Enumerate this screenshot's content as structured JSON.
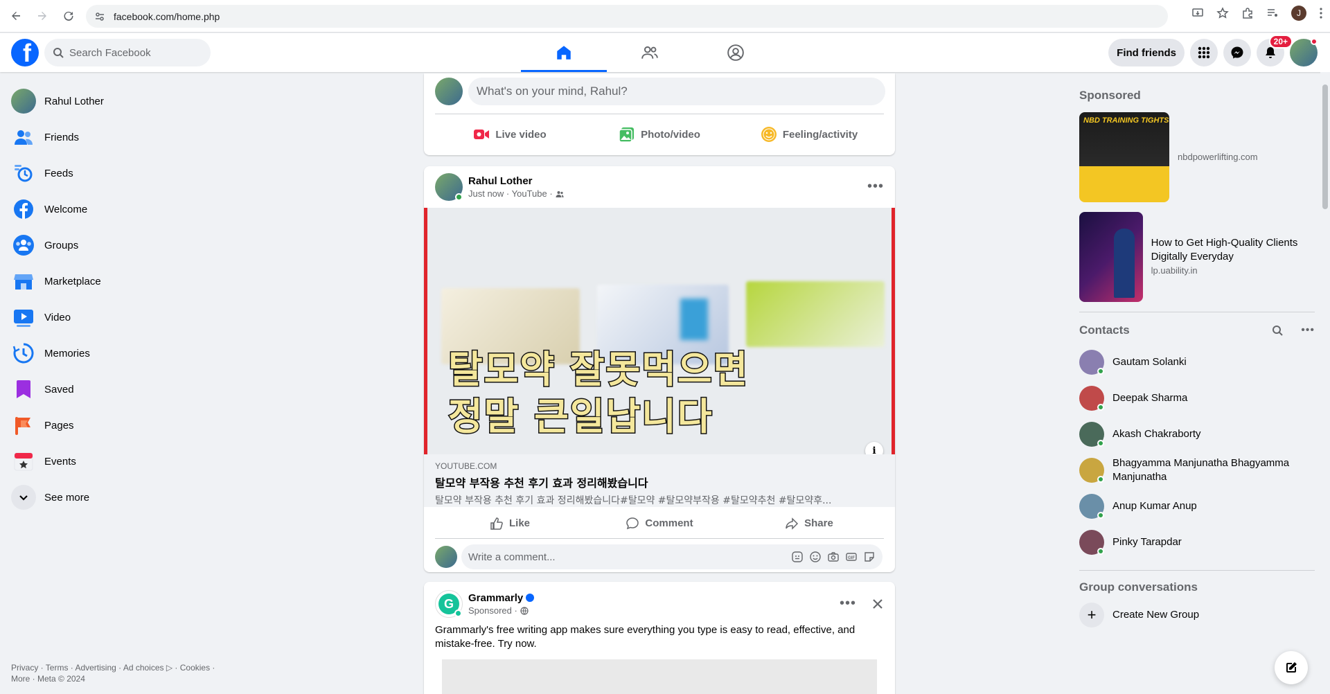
{
  "browser": {
    "url": "facebook.com/home.php",
    "profile_initial": "J"
  },
  "header": {
    "logo": "f",
    "search_placeholder": "Search Facebook",
    "find_friends": "Find friends",
    "notifications_badge": "20+"
  },
  "left_nav": {
    "items": [
      {
        "label": "Rahul Lother",
        "icon": "profile-avatar"
      },
      {
        "label": "Friends",
        "icon": "friends-icon"
      },
      {
        "label": "Feeds",
        "icon": "feeds-icon"
      },
      {
        "label": "Welcome",
        "icon": "facebook-icon"
      },
      {
        "label": "Groups",
        "icon": "groups-icon"
      },
      {
        "label": "Marketplace",
        "icon": "marketplace-icon"
      },
      {
        "label": "Video",
        "icon": "video-icon"
      },
      {
        "label": "Memories",
        "icon": "memories-icon"
      },
      {
        "label": "Saved",
        "icon": "saved-icon"
      },
      {
        "label": "Pages",
        "icon": "pages-icon"
      },
      {
        "label": "Events",
        "icon": "events-icon"
      },
      {
        "label": "See more",
        "icon": "chevron-down-icon"
      }
    ],
    "footer_line1": "Privacy · Terms · Advertising · Ad choices ▷ · Cookies ·",
    "footer_line2": "More · Meta © 2024"
  },
  "composer": {
    "placeholder": "What's on your mind, Rahul?",
    "live_video": "Live video",
    "photo_video": "Photo/video",
    "feeling": "Feeling/activity"
  },
  "post": {
    "author": "Rahul Lother",
    "time": "Just now · YouTube ·",
    "image_line1": "탈모약 잘못먹으면",
    "image_line2": "정말 큰일납니다",
    "link_domain": "YOUTUBE.COM",
    "link_title": "탈모약 부작용 추천 후기 효과 정리해봤습니다",
    "link_desc": "탈모약 부작용 추천 후기 효과 정리해봤습니다#탈모약 #탈모약부작용 #탈모약추천 #탈모약후...",
    "like": "Like",
    "comment": "Comment",
    "share": "Share",
    "comment_placeholder": "Write a comment..."
  },
  "ad_post": {
    "author": "Grammarly",
    "sub": "Sponsored ·",
    "text": "Grammarly's free writing app makes sure everything you type is easy to read, effective, and mistake-free. Try now."
  },
  "right_rail": {
    "sponsored_title": "Sponsored",
    "sponsored": [
      {
        "image_label": "NBD TRAINING TIGHTS",
        "title": "",
        "domain": "nbdpowerlifting.com"
      },
      {
        "image_label": "",
        "title": "How to Get High-Quality Clients Digitally Everyday",
        "domain": "lp.uability.in"
      }
    ],
    "contacts_title": "Contacts",
    "contacts": [
      {
        "name": "Gautam Solanki",
        "color": "#8a7fb0"
      },
      {
        "name": "Deepak Sharma",
        "color": "#c04a4a"
      },
      {
        "name": "Akash Chakraborty",
        "color": "#4a6a5a"
      },
      {
        "name": "Bhagyamma Manjunatha Bhagyamma Manjunatha",
        "color": "#c9a640"
      },
      {
        "name": "Anup Kumar Anup",
        "color": "#6a8fa8"
      },
      {
        "name": "Pinky Tarapdar",
        "color": "#7a4a5a"
      }
    ],
    "group_conv_title": "Group conversations",
    "create_group": "Create New Group"
  },
  "colors": {
    "brand": "#0866ff",
    "live_red": "#f02849",
    "photo_green": "#45bd62",
    "feeling_yellow": "#f7b928",
    "online": "#31a24c"
  }
}
